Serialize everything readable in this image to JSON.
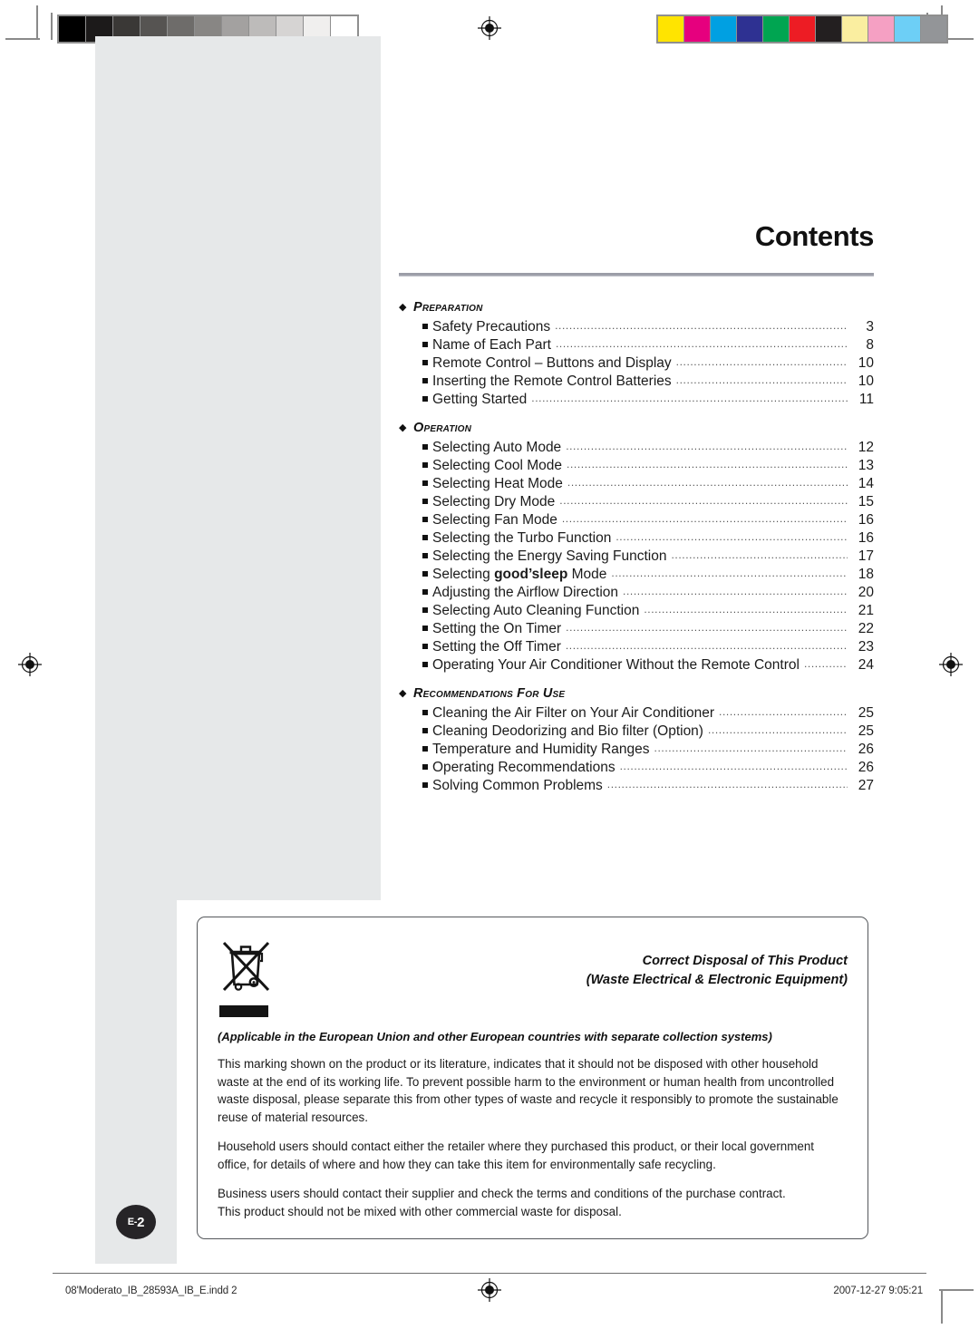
{
  "page": {
    "heading": "Contents",
    "page_badge": "E-2"
  },
  "prepress": {
    "gray_strip_label": "grayscale-calibration-strip",
    "gray_swatches": [
      "#000000",
      "#1c1a1a",
      "#3a3836",
      "#565452",
      "#6e6c6a",
      "#888684",
      "#a3a1a0",
      "#bdbbba",
      "#d6d4d3",
      "#f0efee",
      "#ffffff"
    ],
    "color_swatches": [
      "#ffe400",
      "#e6007e",
      "#00a0e2",
      "#2e3192",
      "#00a551",
      "#ed1c24",
      "#231f20",
      "#faeea0",
      "#f5a0c3",
      "#6dcff6",
      "#939598"
    ],
    "registration_mark": "registration-target-icon"
  },
  "toc": {
    "sections": [
      {
        "title": "Preparation",
        "items": [
          {
            "label": "Safety Precautions",
            "page": "3"
          },
          {
            "label": "Name of Each Part",
            "page": "8"
          },
          {
            "label": "Remote Control – Buttons and Display",
            "page": "10"
          },
          {
            "label": "Inserting the Remote Control Batteries",
            "page": "10"
          },
          {
            "label": "Getting Started",
            "page": "11"
          }
        ]
      },
      {
        "title": "Operation",
        "items": [
          {
            "label": "Selecting Auto Mode",
            "page": "12"
          },
          {
            "label": "Selecting Cool Mode",
            "page": "13"
          },
          {
            "label": "Selecting Heat Mode",
            "page": "14"
          },
          {
            "label": "Selecting Dry Mode",
            "page": "15"
          },
          {
            "label": "Selecting Fan Mode",
            "page": "16"
          },
          {
            "label": "Selecting the Turbo Function",
            "page": "16"
          },
          {
            "label": "Selecting the Energy Saving Function",
            "page": "17"
          },
          {
            "label": "Selecting good’sleep Mode",
            "page": "18",
            "bold_part": "good’sleep"
          },
          {
            "label": "Adjusting the Airflow Direction",
            "page": "20"
          },
          {
            "label": "Selecting Auto Cleaning Function",
            "page": "21"
          },
          {
            "label": "Setting the On Timer",
            "page": "22"
          },
          {
            "label": "Setting the Off Timer",
            "page": "23"
          },
          {
            "label": "Operating Your Air Conditioner Without the Remote Control",
            "page": "24"
          }
        ]
      },
      {
        "title": "Recommendations for use",
        "items": [
          {
            "label": "Cleaning the Air Filter on Your Air Conditioner",
            "page": "25"
          },
          {
            "label": "Cleaning Deodorizing and Bio filter (Option)",
            "page": "25"
          },
          {
            "label": "Temperature and Humidity Ranges",
            "page": "26"
          },
          {
            "label": "Operating Recommendations",
            "page": "26"
          },
          {
            "label": "Solving Common Problems",
            "page": "27"
          }
        ]
      }
    ]
  },
  "disposal": {
    "icon_name": "crossed-out-wheelie-bin-icon",
    "heading_line1": "Correct Disposal of This Product",
    "heading_line2": "(Waste Electrical & Electronic Equipment)",
    "applicable": "(Applicable in the European Union and other European countries with separate collection systems)",
    "paragraphs": [
      "This marking shown on the product or its literature, indicates that it should not be disposed with other household waste at the end of its working life. To prevent possible harm to the environment or human health from uncontrolled waste disposal, please separate this from other types of waste and recycle it responsibly to promote the sustainable reuse of material resources.",
      "Household users should contact either the retailer where they purchased this product, or their local government office, for details of where and how they can take this item for environmentally safe recycling.",
      "Business users should contact their supplier and check the terms and conditions of the purchase contract.\nThis product should not be mixed with other commercial waste for disposal."
    ]
  },
  "footer": {
    "file_name": "08'Moderato_IB_28593A_IB_E.indd   2",
    "timestamp": "2007-12-27   9:05:21"
  }
}
